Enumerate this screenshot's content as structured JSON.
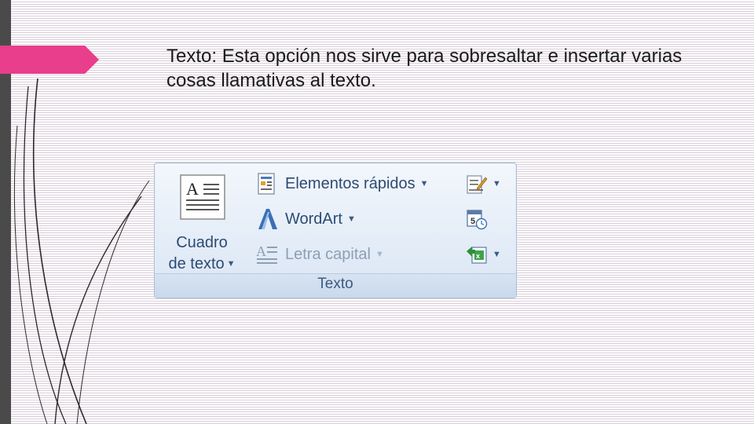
{
  "slide": {
    "text_bold": "Texto:",
    "text_rest": " Esta opción nos sirve para sobresaltar e insertar varias cosas llamativas al texto."
  },
  "ribbon": {
    "group_label": "Texto",
    "cuadro": {
      "line1": "Cuadro",
      "line2": "de texto",
      "icon": "text-box-icon"
    },
    "elementos": {
      "label": "Elementos rápidos",
      "icon": "quick-parts-icon"
    },
    "wordart": {
      "label": "WordArt",
      "icon": "wordart-icon"
    },
    "letra": {
      "label": "Letra capital",
      "icon": "drop-cap-icon",
      "disabled": true
    },
    "firma": {
      "icon": "signature-line-icon"
    },
    "fecha": {
      "icon": "date-time-icon"
    },
    "objeto": {
      "icon": "insert-object-icon"
    }
  },
  "colors": {
    "accent_pink": "#e83e8c",
    "ribbon_text": "#2c4b73",
    "sidebar": "#4a4a4a"
  }
}
